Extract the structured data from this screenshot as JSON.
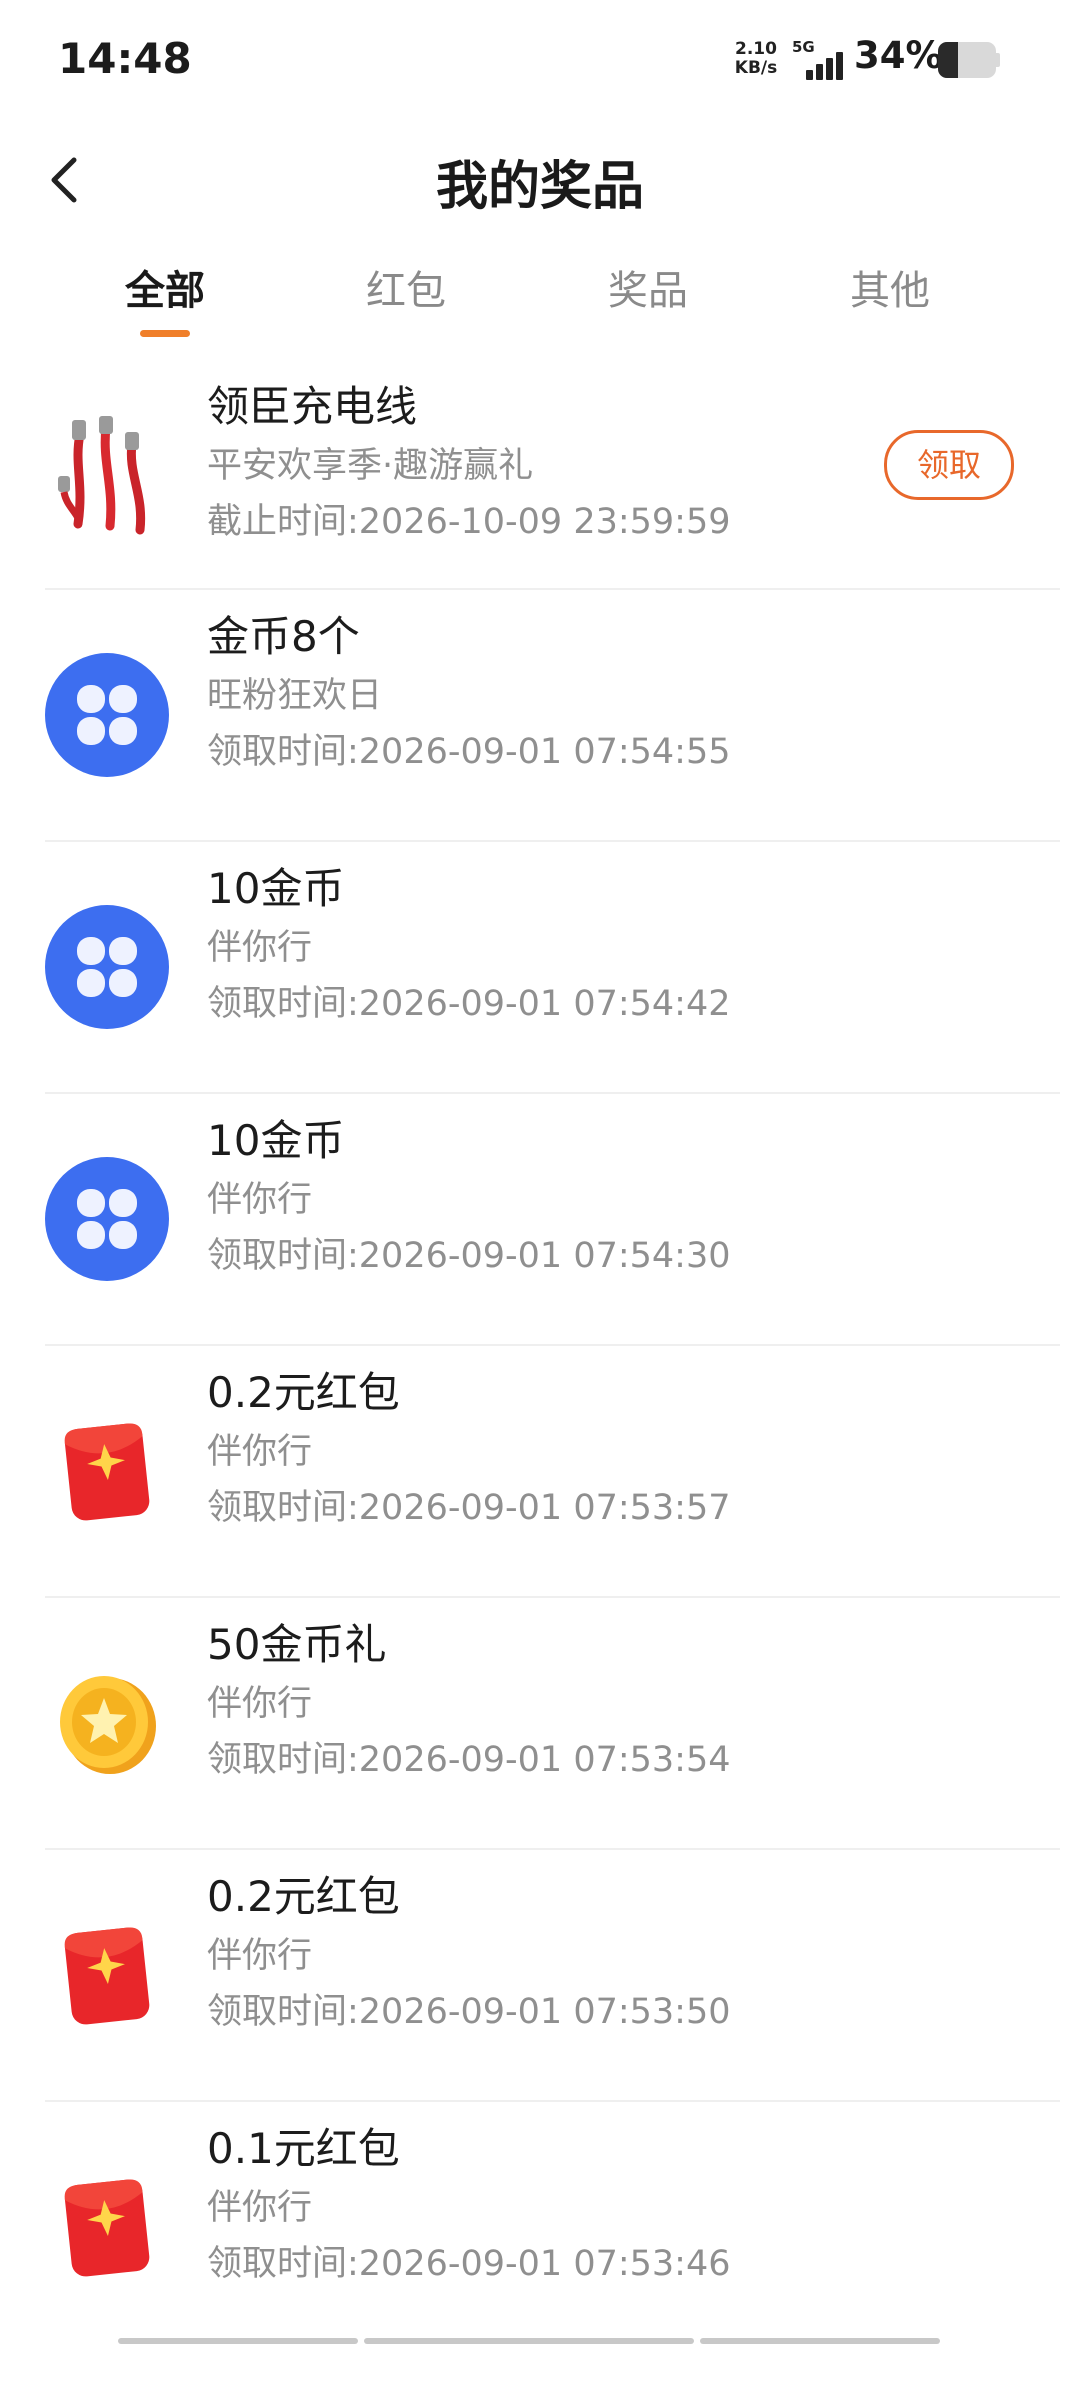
{
  "status_bar": {
    "time": "14:48",
    "net_speed_value": "2.10",
    "net_speed_unit": "KB/s",
    "network_type": "5G",
    "battery_percent": "34%",
    "battery_level": 0.34
  },
  "header": {
    "title": "我的奖品",
    "back_icon": "chevron-left-icon"
  },
  "tabs": [
    {
      "label": "全部",
      "active": true
    },
    {
      "label": "红包",
      "active": false
    },
    {
      "label": "奖品",
      "active": false
    },
    {
      "label": "其他",
      "active": false
    }
  ],
  "accent_color": "#f07f2a",
  "claim_color": "#e8682b",
  "prizes": [
    {
      "name": "领臣充电线",
      "source": "平安欢享季·趣游赢礼",
      "time": "截止时间:2026-10-09 23:59:59",
      "icon": "charging-cable-icon",
      "action": "领取"
    },
    {
      "name": "金币8个",
      "source": "旺粉狂欢日",
      "time": "领取时间:2026-09-01 07:54:55",
      "icon": "app-logo-icon"
    },
    {
      "name": "10金币",
      "source": "伴你行",
      "time": "领取时间:2026-09-01 07:54:42",
      "icon": "app-logo-icon"
    },
    {
      "name": "10金币",
      "source": "伴你行",
      "time": "领取时间:2026-09-01 07:54:30",
      "icon": "app-logo-icon"
    },
    {
      "name": "0.2元红包",
      "source": "伴你行",
      "time": "领取时间:2026-09-01 07:53:57",
      "icon": "red-envelope-icon"
    },
    {
      "name": "50金币礼",
      "source": "伴你行",
      "time": "领取时间:2026-09-01 07:53:54",
      "icon": "gold-coin-icon"
    },
    {
      "name": "0.2元红包",
      "source": "伴你行",
      "time": "领取时间:2026-09-01 07:53:50",
      "icon": "red-envelope-icon"
    },
    {
      "name": "0.1元红包",
      "source": "伴你行",
      "time": "领取时间:2026-09-01 07:53:46",
      "icon": "red-envelope-icon"
    }
  ]
}
